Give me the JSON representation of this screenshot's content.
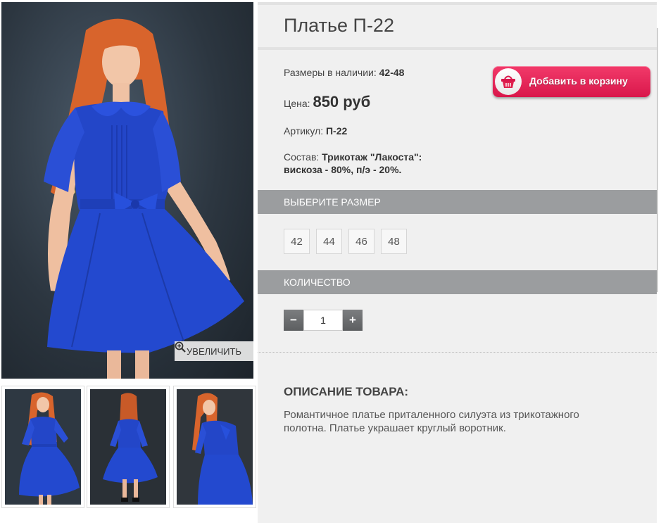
{
  "product": {
    "title": "Платье П-22",
    "sizes_available_label": "Размеры в наличии:",
    "sizes_available_value": "42-48",
    "price_label": "Цена:",
    "price_value": "850 руб",
    "article_label": "Артикул:",
    "article_value": "П-22",
    "composition_label": "Состав:",
    "composition_value_line1": "Трикотаж \"Лакоста\":",
    "composition_value_line2": "вискоза - 80%, п/э - 20%."
  },
  "cart_button": {
    "label": "Добавить в корзину",
    "icon": "basket-icon"
  },
  "gallery": {
    "zoom_label": "УВЕЛИЧИТЬ",
    "zoom_icon": "magnifier-plus-icon",
    "thumbnail_count": 3
  },
  "size_section": {
    "header": "ВЫБЕРИТЕ РАЗМЕР",
    "options": [
      "42",
      "44",
      "46",
      "48"
    ]
  },
  "quantity_section": {
    "header": "КОЛИЧЕСТВО",
    "minus_label": "−",
    "plus_label": "+",
    "value": "1"
  },
  "description": {
    "title": "ОПИСАНИЕ ТОВАРА:",
    "text": "Романтичное платье приталенного силуэта из трикотажного полотна. Платье украшает круглый воротник."
  },
  "colors": {
    "accent_pink": "#e0234f",
    "section_bar": "#9b9d9f",
    "panel_bg": "#f0f0f0",
    "dress_blue": "#2346c8"
  }
}
